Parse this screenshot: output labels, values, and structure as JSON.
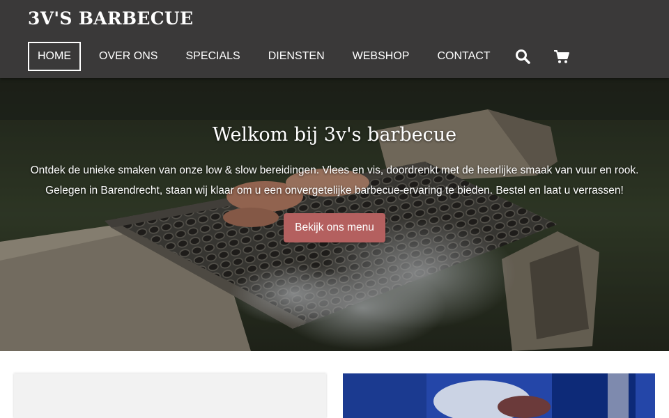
{
  "site": {
    "brand": "3V'S BARBECUE"
  },
  "nav": {
    "items": [
      {
        "label": "HOME",
        "active": true
      },
      {
        "label": "OVER ONS"
      },
      {
        "label": "SPECIALS"
      },
      {
        "label": "DIENSTEN"
      },
      {
        "label": "WEBSHOP"
      },
      {
        "label": "CONTACT"
      }
    ],
    "icons": [
      "search-icon",
      "cart-icon"
    ]
  },
  "hero": {
    "title": "Welkom bij 3v's barbecue",
    "line1": "Ontdek de unieke smaken van onze low & slow bereidingen. Vlees en vis, doordrenkt met de heerlijke smaak van vuur en rook.",
    "line2": "Gelegen in Barendrecht, staan wij klaar om u een onvergetelijke barbecue-ervaring te bieden. Bestel en laat u verrassen!",
    "cta": "Bekijk ons menu"
  },
  "colors": {
    "header_bg": "#3a3939",
    "cta_bg": "#b4605f",
    "text_light": "#ffffff"
  }
}
